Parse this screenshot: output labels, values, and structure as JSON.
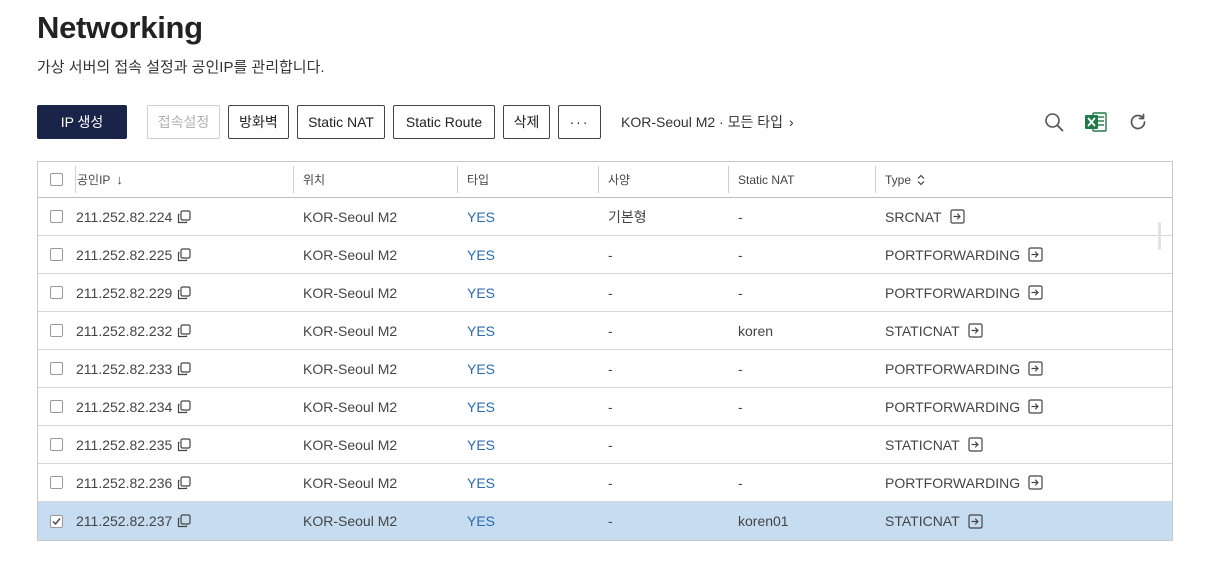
{
  "page": {
    "title": "Networking",
    "subtitle": "가상 서버의 접속 설정과 공인IP를 관리합니다."
  },
  "toolbar": {
    "create_label": "IP 생성",
    "connect_label": "접속설정",
    "firewall_label": "방화벽",
    "static_nat_label": "Static NAT",
    "static_route_label": "Static Route",
    "delete_label": "삭제",
    "more_label": "···",
    "filter_label": "KOR-Seoul M2 · 모든 타입",
    "filter_chevron": "›"
  },
  "icons": {
    "search": "search-icon",
    "excel": "excel-icon",
    "refresh": "refresh-icon",
    "excel_color": "#1f7a45",
    "excel_letter": "X"
  },
  "table": {
    "headers": {
      "ip": "공인IP",
      "ip_sort": "↓",
      "location": "위치",
      "type": "타입",
      "spec": "사양",
      "static_nat": "Static NAT",
      "kind": "Type"
    },
    "rows": [
      {
        "ip": "211.252.82.224",
        "location": "KOR-Seoul M2",
        "type": "YES",
        "spec": "기본형",
        "static_nat": "-",
        "kind": "SRCNAT",
        "checked": false
      },
      {
        "ip": "211.252.82.225",
        "location": "KOR-Seoul M2",
        "type": "YES",
        "spec": "-",
        "static_nat": "-",
        "kind": "PORTFORWARDING",
        "checked": false
      },
      {
        "ip": "211.252.82.229",
        "location": "KOR-Seoul M2",
        "type": "YES",
        "spec": "-",
        "static_nat": "-",
        "kind": "PORTFORWARDING",
        "checked": false
      },
      {
        "ip": "211.252.82.232",
        "location": "KOR-Seoul M2",
        "type": "YES",
        "spec": "-",
        "static_nat": "koren",
        "kind": "STATICNAT",
        "checked": false
      },
      {
        "ip": "211.252.82.233",
        "location": "KOR-Seoul M2",
        "type": "YES",
        "spec": "-",
        "static_nat": "-",
        "kind": "PORTFORWARDING",
        "checked": false
      },
      {
        "ip": "211.252.82.234",
        "location": "KOR-Seoul M2",
        "type": "YES",
        "spec": "-",
        "static_nat": "-",
        "kind": "PORTFORWARDING",
        "checked": false
      },
      {
        "ip": "211.252.82.235",
        "location": "KOR-Seoul M2",
        "type": "YES",
        "spec": "-",
        "static_nat": "",
        "kind": "STATICNAT",
        "checked": false
      },
      {
        "ip": "211.252.82.236",
        "location": "KOR-Seoul M2",
        "type": "YES",
        "spec": "-",
        "static_nat": "-",
        "kind": "PORTFORWARDING",
        "checked": false
      },
      {
        "ip": "211.252.82.237",
        "location": "KOR-Seoul M2",
        "type": "YES",
        "spec": "-",
        "static_nat": "koren01",
        "kind": "STATICNAT",
        "checked": true
      }
    ]
  },
  "colors": {
    "primary_button": "#1a2448",
    "yes_text": "#2b6cb0",
    "selected_row": "#c6dcf0"
  }
}
